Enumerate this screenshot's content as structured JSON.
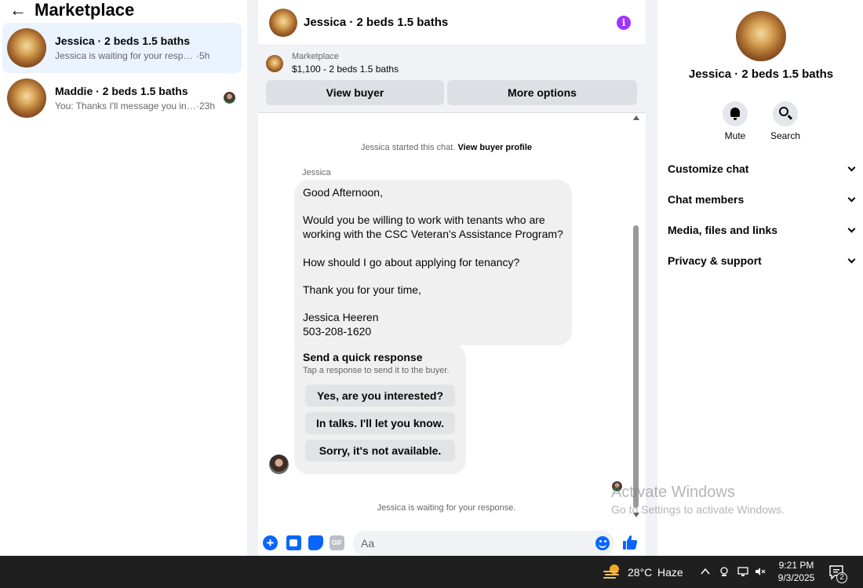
{
  "left": {
    "title": "Marketplace",
    "conversations": [
      {
        "title": "Jessica · 2 beds 1.5 baths",
        "preview": "Jessica is waiting for your response.",
        "time": "·5h"
      },
      {
        "title": "Maddie · 2 beds 1.5 baths",
        "preview": "You: Thanks I'll message you in a ...",
        "time": "·23h"
      }
    ]
  },
  "chat_header": {
    "title": "Jessica · 2 beds 1.5 baths"
  },
  "marketplace_card": {
    "label": "Marketplace",
    "listing": "$1,100 - 2 beds 1.5 baths",
    "view_buyer": "View buyer",
    "more_options": "More options"
  },
  "chat": {
    "started_text": "Jessica started this chat.",
    "view_profile": "View buyer profile",
    "sender": "Jessica",
    "message": "Good Afternoon,\n\nWould you be willing to work with tenants who are working with the CSC Veteran's Assistance Program?\n\nHow should I go about applying for tenancy?\n\nThank you for your time,\n\nJessica Heeren\n503-208-1620",
    "quick_title": "Send a quick response",
    "quick_sub": "Tap a response to send it to the buyer.",
    "quick_replies": [
      "Yes, are you interested?",
      "In talks. I'll let you know.",
      "Sorry, it's not available."
    ],
    "waiting_text": "Jessica is waiting for your response."
  },
  "composer": {
    "placeholder": "Aa",
    "gif": "GIF"
  },
  "right": {
    "title": "Jessica · 2 beds 1.5 baths",
    "mute": "Mute",
    "search": "Search",
    "sections": [
      "Customize chat",
      "Chat members",
      "Media, files and links",
      "Privacy & support"
    ]
  },
  "watermark": {
    "line1": "Activate Windows",
    "line2": "Go to Settings to activate Windows."
  },
  "taskbar": {
    "temperature": "28°C",
    "weather": "Haze",
    "time": "9:21 PM",
    "date": "9/3/2025",
    "notifications": "2"
  },
  "colors": {
    "accent": "#0866ff",
    "info": "#a033ff",
    "active_bg": "#ebf3ff"
  }
}
